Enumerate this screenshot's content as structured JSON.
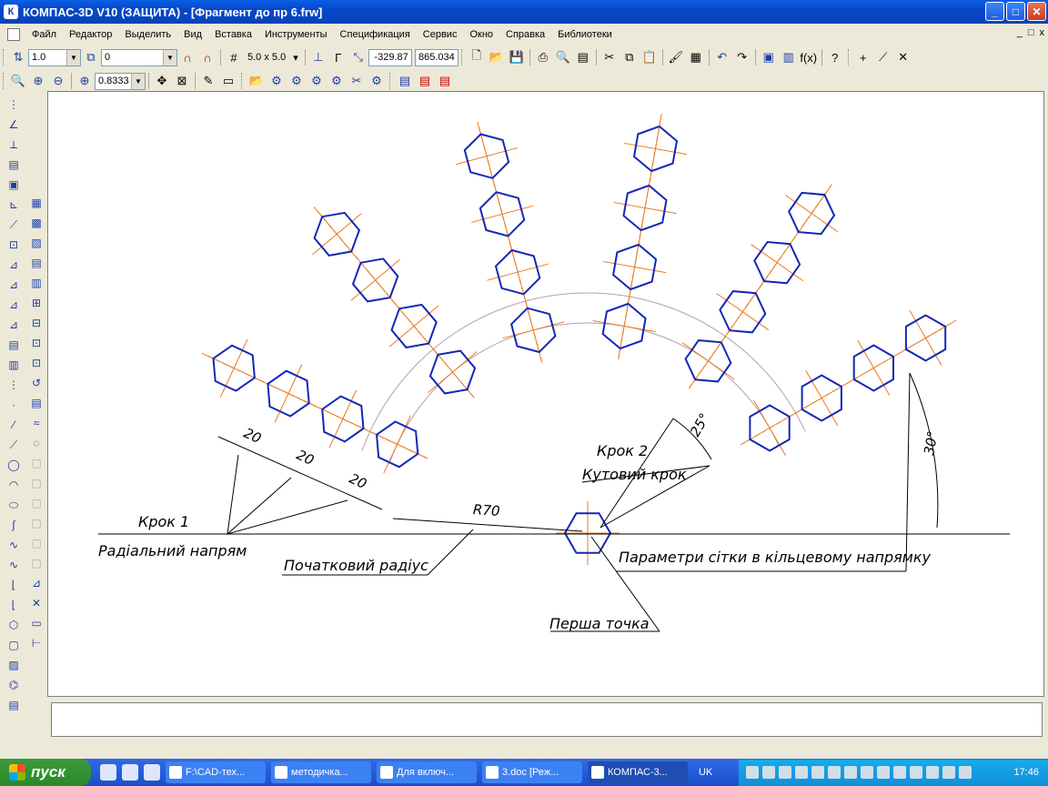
{
  "window": {
    "title": "КОМПАС-3D V10 (ЗАЩИТА) - [Фрагмент до пр 6.frw]",
    "app_icon_letter": "К",
    "minimize": "_",
    "maximize": "□",
    "close": "✕"
  },
  "menu": {
    "items": [
      "Файл",
      "Редактор",
      "Выделить",
      "Вид",
      "Вставка",
      "Инструменты",
      "Спецификация",
      "Сервис",
      "Окно",
      "Справка",
      "Библиотеки"
    ],
    "mdi_buttons": [
      "_",
      "□",
      "x"
    ]
  },
  "toolbar1": {
    "line_style_value": "1.0",
    "layer_value": "0",
    "grid_label": "5.0 x 5.0",
    "coord_x": "-329.87",
    "coord_y": "865.034"
  },
  "toolbar2": {
    "zoom_value": "0.8333"
  },
  "drawing": {
    "labels": {
      "step1": "Крок 1",
      "radial": "Радіальний напрям",
      "start_radius": "Початковий радіус",
      "step2": "Крок 2",
      "angular_step": "Кутовий крок",
      "grid_params": "Параметри сітки в кільцевому напрямку",
      "first_point": "Перша точка"
    },
    "dimensions": {
      "d1": "20",
      "d2": "20",
      "d3": "20",
      "radius": "R70",
      "angle_step": "25°",
      "angle_start": "30°"
    },
    "colors": {
      "hexagon": "#1428b4",
      "axis": "#e8781e",
      "arc": "#b49fb0",
      "line": "#000000"
    }
  },
  "taskbar": {
    "start": "пуск",
    "tasks": [
      "F:\\CAD-тех...",
      "методичка...",
      "Для включ...",
      "3.doc [Реж...",
      "КОМПАС-3..."
    ],
    "lang": "UK",
    "clock": "17:46"
  }
}
